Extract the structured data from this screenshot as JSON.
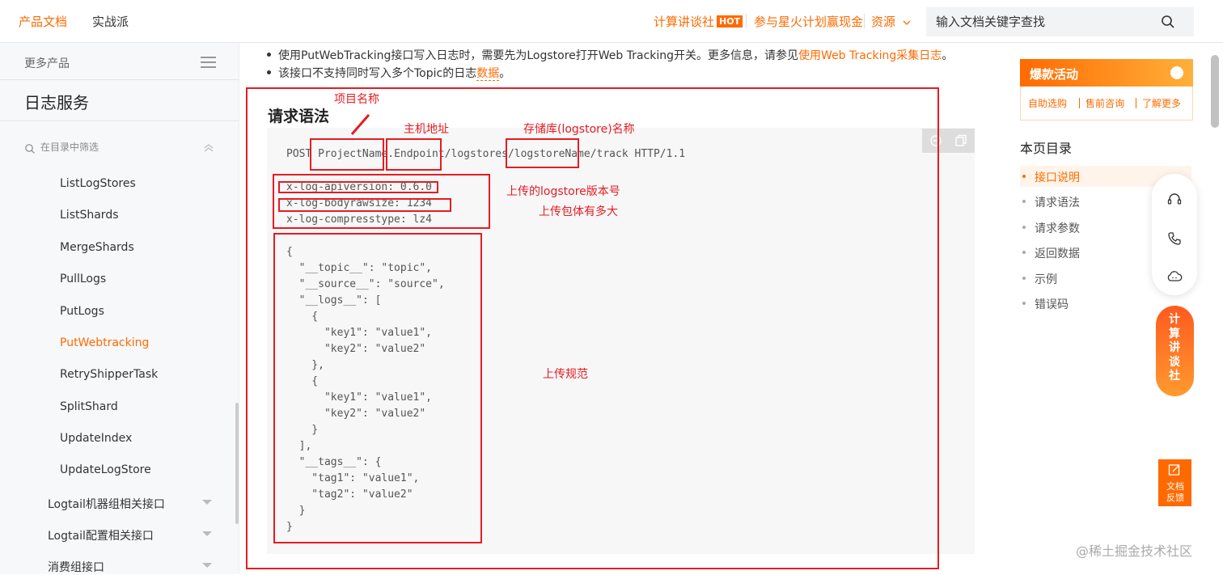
{
  "header": {
    "tabs": [
      {
        "label": "产品文档",
        "active": true
      },
      {
        "label": "实战派",
        "active": false
      }
    ],
    "links": {
      "computing_forum": "计算讲谈社",
      "hot_badge": "HOT",
      "star_plan": "参与星火计划赢现金",
      "resources": "资源"
    },
    "search": {
      "placeholder": "输入文档关键字查找"
    }
  },
  "sidebar": {
    "more_products": "更多产品",
    "title": "日志服务",
    "filter_placeholder": "在目录中筛选",
    "items": [
      {
        "label": "ListLogStores",
        "active": false
      },
      {
        "label": "ListShards",
        "active": false
      },
      {
        "label": "MergeShards",
        "active": false
      },
      {
        "label": "PullLogs",
        "active": false
      },
      {
        "label": "PutLogs",
        "active": false
      },
      {
        "label": "PutWebtracking",
        "active": true
      },
      {
        "label": "RetryShipperTask",
        "active": false
      },
      {
        "label": "SplitShard",
        "active": false
      },
      {
        "label": "UpdateIndex",
        "active": false
      },
      {
        "label": "UpdateLogStore",
        "active": false
      }
    ],
    "groups": [
      {
        "label": "Logtail机器组相关接口"
      },
      {
        "label": "Logtail配置相关接口"
      },
      {
        "label": "消费组接口"
      }
    ]
  },
  "main": {
    "bullets": [
      {
        "text": "使用PutWebTracking接口写入日志时，需要先为Logstore打开Web Tracking开关。更多信息，请参见",
        "link": "使用Web Tracking采集日志",
        "suffix": "。"
      },
      {
        "text": "该接口不支持同时写入多个Topic的日志",
        "link": "数据",
        "suffix": "。"
      }
    ],
    "section_title": "请求语法",
    "code": {
      "request_line": {
        "method": "POST ",
        "project": "ProjectName",
        "dot": ".",
        "endpoint": "Endpoint",
        "path1": "/logstores/",
        "logstore": "logstoreName",
        "path2": "/track HTTP/1.1"
      },
      "headers": [
        "x-log-apiversion: 0.6.0",
        "x-log-bodyrawsize: 1234",
        "x-log-compresstype: lz4"
      ],
      "body": [
        "{",
        "  \"__topic__\": \"topic\",",
        "  \"__source__\": \"source\",",
        "  \"__logs__\": [",
        "    {",
        "      \"key1\": \"value1\",",
        "      \"key2\": \"value2\"",
        "    },",
        "    {",
        "      \"key1\": \"value1\",",
        "      \"key2\": \"value2\"",
        "    }",
        "  ],",
        "  \"__tags__\": {",
        "    \"tag1\": \"value1\",",
        "    \"tag2\": \"value2\"",
        "  }",
        "}"
      ]
    },
    "annotations": {
      "project_name": "项目名称",
      "host": "主机地址",
      "logstore_name": "存储库(logstore)名称",
      "api_version": "上传的logstore版本号",
      "body_size": "上传包体有多大",
      "upload_spec": "上传规范"
    }
  },
  "right": {
    "promo": {
      "title": "爆款活动",
      "links": [
        "自助选购",
        "售前咨询",
        "了解更多"
      ]
    },
    "toc_title": "本页目录",
    "toc": [
      {
        "label": "接口说明",
        "active": true
      },
      {
        "label": "请求语法",
        "active": false
      },
      {
        "label": "请求参数",
        "active": false
      },
      {
        "label": "返回数据",
        "active": false
      },
      {
        "label": "示例",
        "active": false
      },
      {
        "label": "错误码",
        "active": false
      }
    ],
    "float_talk": "计算讲谈社",
    "feedback": "文档反馈",
    "watermark": "@稀土掘金技术社区"
  },
  "colors": {
    "accent": "#ff6a00",
    "annotation_red": "#e51c23"
  }
}
